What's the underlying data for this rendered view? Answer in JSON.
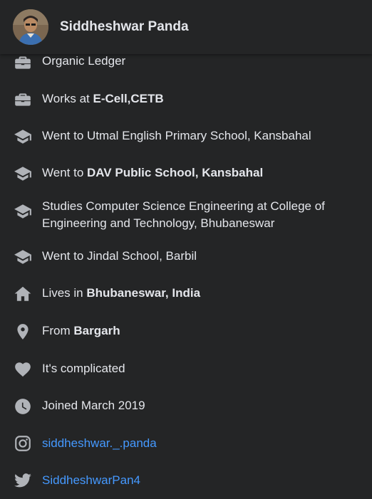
{
  "header": {
    "name": "Siddheshwar Panda"
  },
  "items": [
    {
      "icon": "briefcase-icon",
      "text": "Organic Ledger"
    },
    {
      "icon": "briefcase-icon",
      "prefix": "Works at ",
      "bold": "E-Cell,CETB"
    },
    {
      "icon": "graduation-cap-icon",
      "text": "Went to Utmal English Primary School, Kansbahal"
    },
    {
      "icon": "graduation-cap-icon",
      "prefix": "Went to ",
      "bold": "DAV Public School, Kansbahal"
    },
    {
      "icon": "graduation-cap-icon",
      "text": "Studies Computer Science Engineering at College of Engineering and Technology, Bhubaneswar"
    },
    {
      "icon": "graduation-cap-icon",
      "text": "Went to Jindal School, Barbil"
    },
    {
      "icon": "home-icon",
      "prefix": "Lives in ",
      "bold": "Bhubaneswar, India"
    },
    {
      "icon": "location-pin-icon",
      "prefix": "From ",
      "bold": "Bargarh"
    },
    {
      "icon": "heart-icon",
      "text": "It's complicated"
    },
    {
      "icon": "clock-icon",
      "text": "Joined March 2019"
    },
    {
      "icon": "instagram-icon",
      "link": "siddheshwar._.panda"
    },
    {
      "icon": "twitter-icon",
      "link": "SiddheshwarPan4"
    }
  ],
  "colors": {
    "background": "#242526",
    "text": "#e4e6eb",
    "icon": "#b0b3b8",
    "link": "#4599ff"
  }
}
